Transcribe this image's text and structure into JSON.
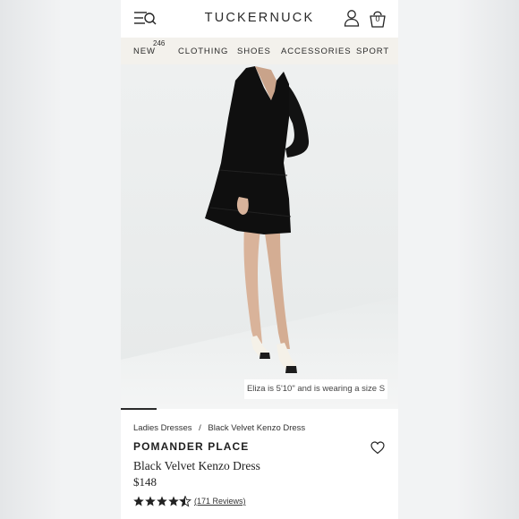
{
  "header": {
    "logo": "TUCKERNUCK",
    "bag_count": "0",
    "menu_icon": "menu-search-icon",
    "account_icon": "user-icon",
    "bag_icon": "shopping-bag-icon"
  },
  "nav": {
    "items": [
      "NEW",
      "CLOTHING",
      "SHOES",
      "ACCESSORIES",
      "SPORT"
    ],
    "new_badge": "246"
  },
  "photo": {
    "caption": "Eliza is 5'10\" and is wearing a size S"
  },
  "product": {
    "breadcrumb": [
      "Ladies Dresses",
      "/",
      "Black Velvet Kenzo Dress"
    ],
    "brand": "POMANDER PLACE",
    "name": "Black Velvet Kenzo Dress",
    "price": "$148",
    "rating": 4.5,
    "rating_max": 5,
    "reviews": "(171 Reviews)",
    "wishlist_icon": "heart-icon"
  },
  "colors": {
    "nav_bg": "#f3f1ec",
    "text": "#222222"
  }
}
